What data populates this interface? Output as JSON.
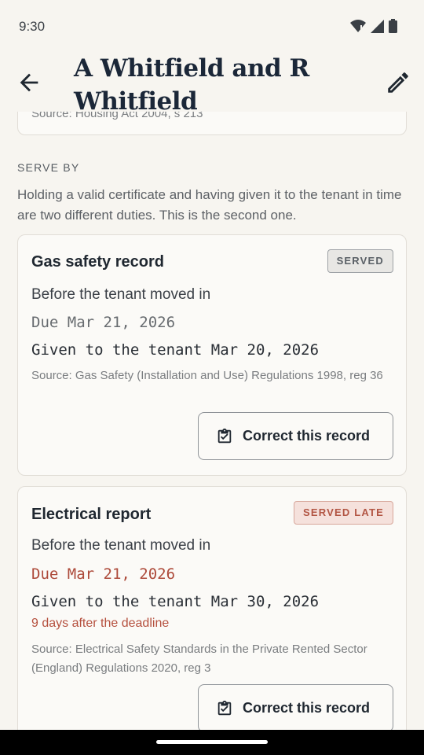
{
  "status_bar": {
    "time": "9:30"
  },
  "app_bar": {
    "title": "A Whitfield and R Whitfield"
  },
  "previous_card": {
    "source": "Source: Housing Act 2004, s 213"
  },
  "section": {
    "label": "SERVE BY",
    "description": "Holding a valid certificate and having given it to the tenant in time are two different duties. This is the second one."
  },
  "cards": [
    {
      "title": "Gas safety record",
      "badge": "SERVED",
      "timing": "Before the tenant moved in",
      "due": "Due Mar 21, 2026",
      "given": "Given to the tenant Mar 20, 2026",
      "source": "Source: Gas Safety (Installation and Use) Regulations 1998, reg 36",
      "button_label": "Correct this record"
    },
    {
      "title": "Electrical report",
      "badge": "SERVED LATE",
      "timing": "Before the tenant moved in",
      "due": "Due Mar 21, 2026",
      "given": "Given to the tenant Mar 30, 2026",
      "late_note": "9 days after the deadline",
      "source": "Source: Electrical Safety Standards in the Private Rented Sector (England) Regulations 2020, reg 3",
      "button_label": "Correct this record"
    }
  ],
  "colors": {
    "background": "#f7f5f0",
    "late_accent": "#b5503e",
    "title": "#1b2738"
  },
  "icons": [
    "back-arrow-icon",
    "edit-pencil-icon",
    "wifi-icon",
    "signal-icon",
    "battery-icon",
    "clipboard-check-icon"
  ]
}
